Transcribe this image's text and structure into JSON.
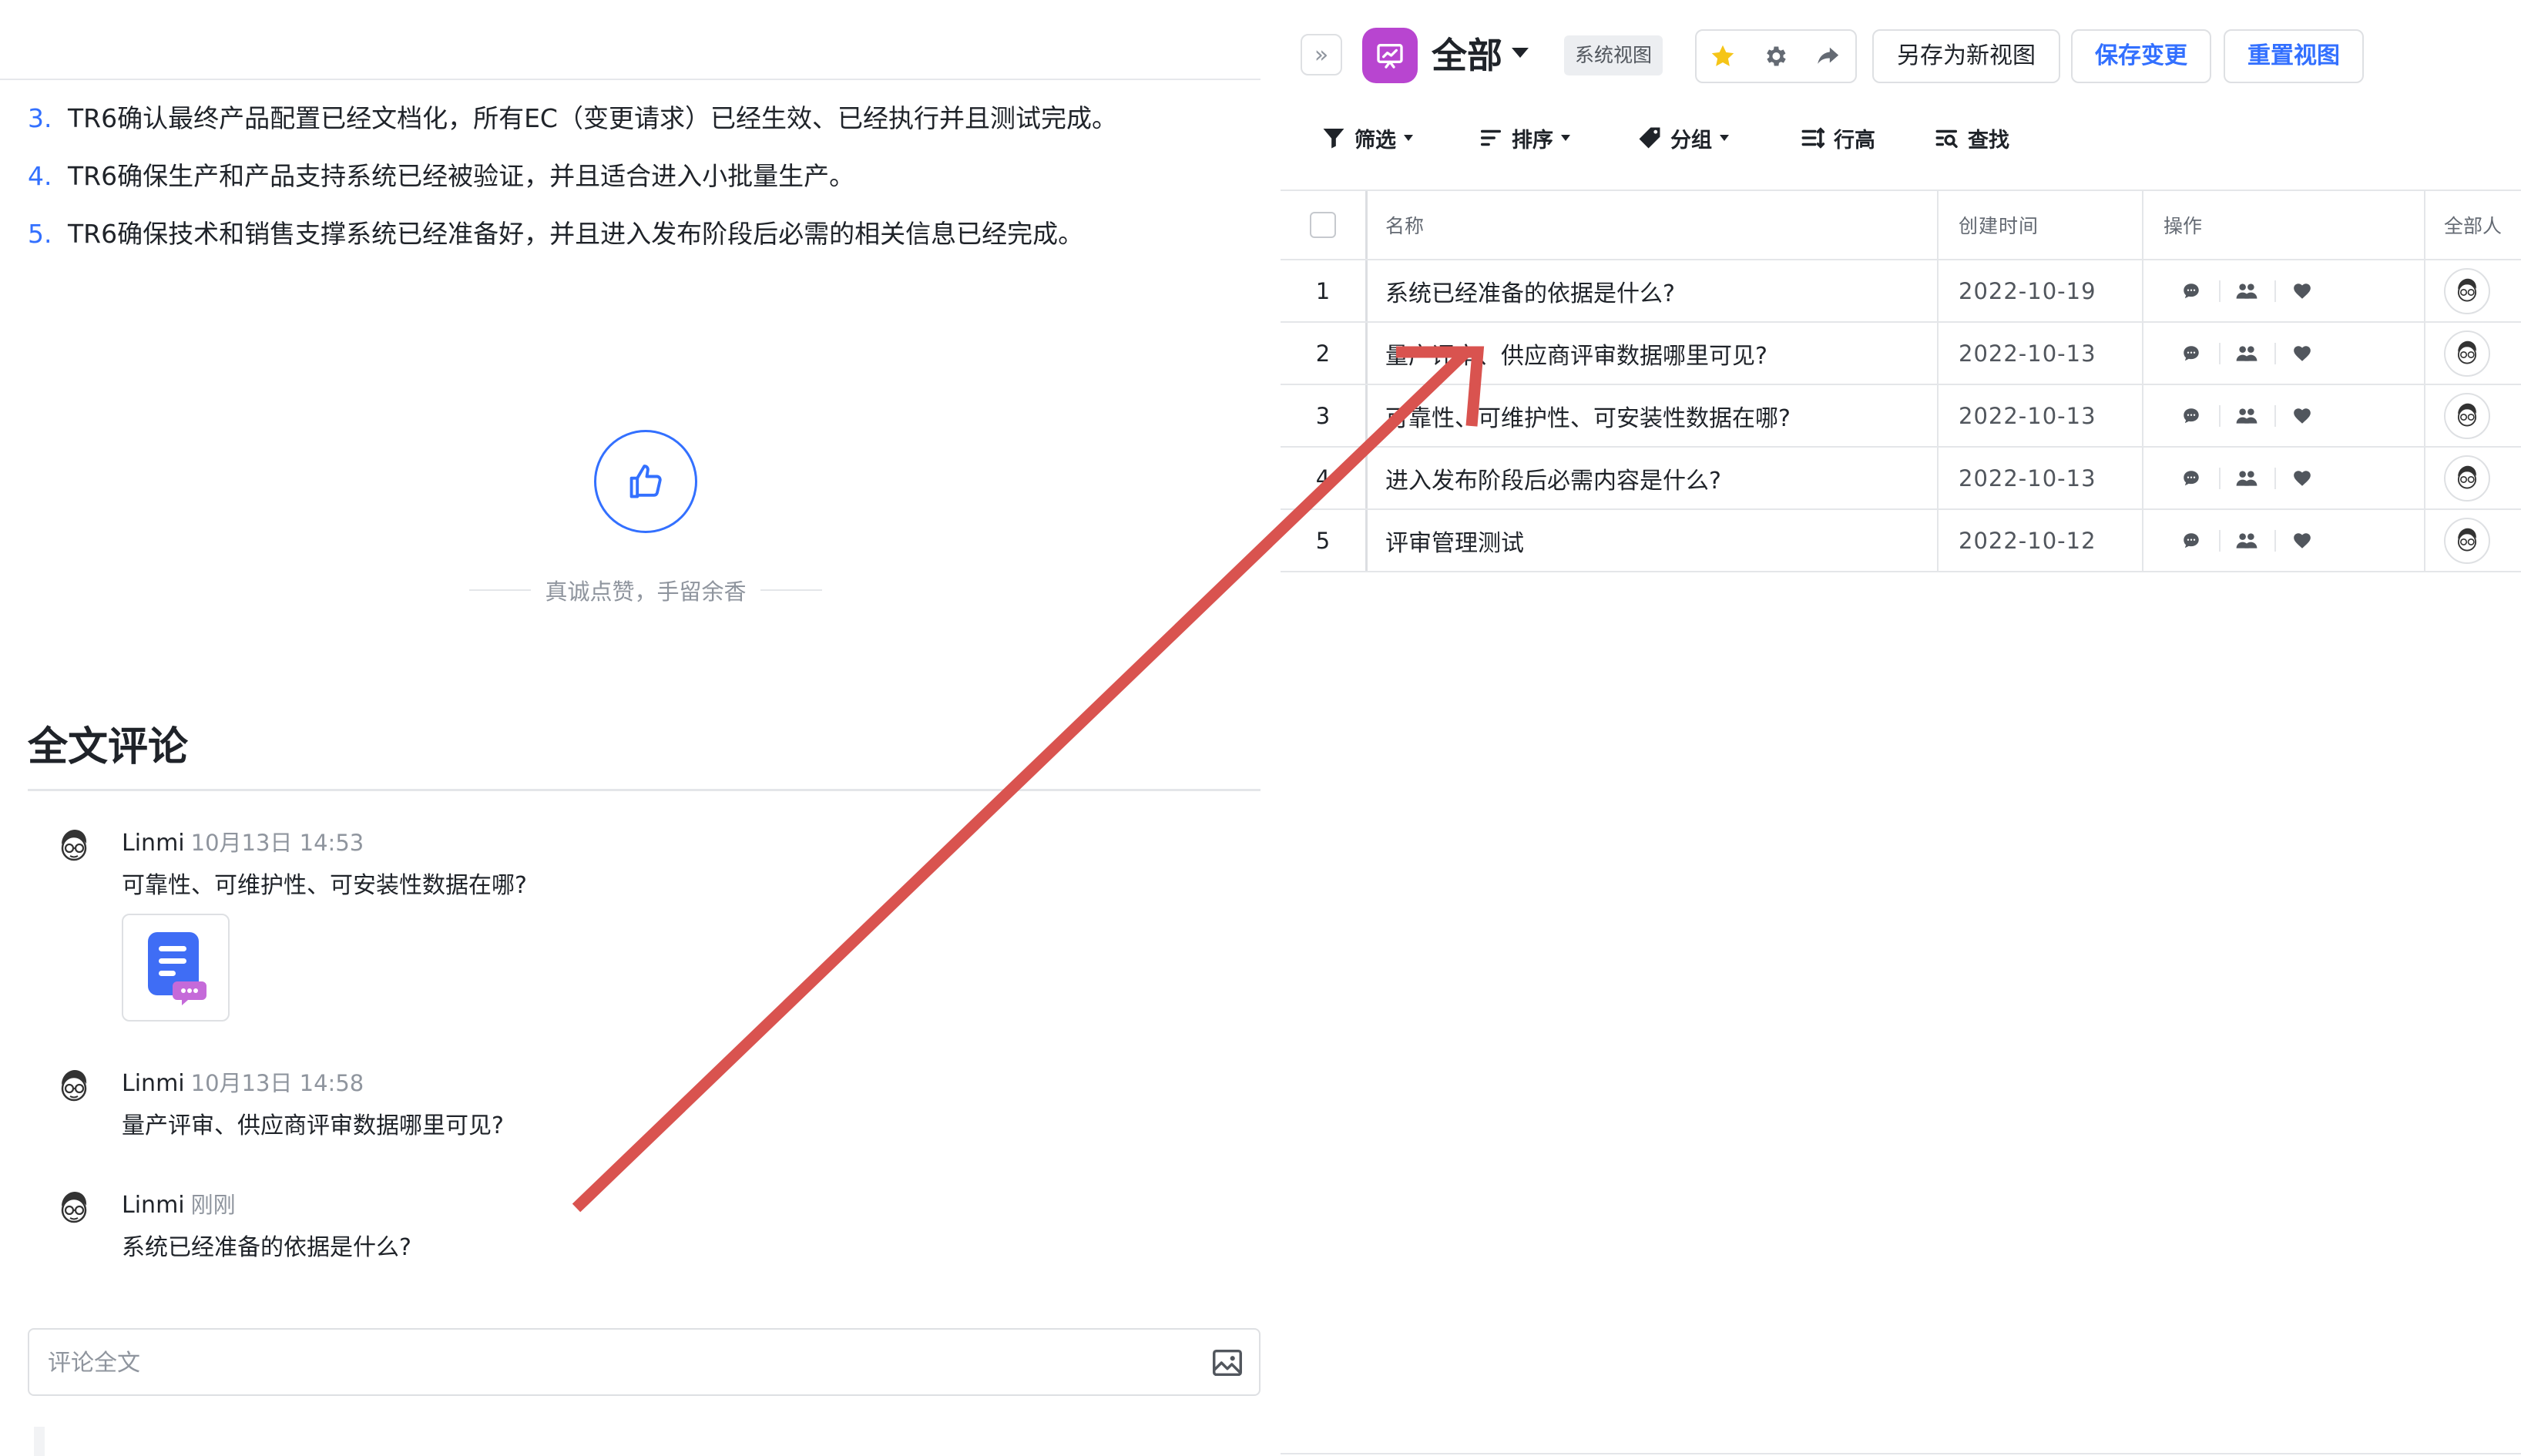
{
  "document": {
    "requirements": [
      {
        "num": "3.",
        "text": "TR6确认最终产品配置已经文档化，所有EC（变更请求）已经生效、已经执行并且测试完成。"
      },
      {
        "num": "4.",
        "text": "TR6确保生产和产品支持系统已经被验证，并且适合进入小批量生产。"
      },
      {
        "num": "5.",
        "text": "TR6确保技术和销售支撑系统已经准备好，并且进入发布阶段后必需的相关信息已经完成。"
      }
    ],
    "like_caption": "真诚点赞，手留余香"
  },
  "comments": {
    "title": "全文评论",
    "items": [
      {
        "author": "Linmi",
        "time": "10月13日 14:53",
        "text": "可靠性、可维护性、可安装性数据在哪?"
      },
      {
        "author": "Linmi",
        "time": "10月13日 14:58",
        "text": "量产评审、供应商评审数据哪里可见?"
      },
      {
        "author": "Linmi",
        "time": "刚刚",
        "text": "系统已经准备的依据是什么?"
      }
    ],
    "input_placeholder": "评论全文"
  },
  "view": {
    "title": "全部",
    "badge": "系统视图",
    "save_as_label": "另存为新视图",
    "save_label": "保存变更",
    "reset_label": "重置视图",
    "expand_glyph": "»",
    "accent": "#3370ff",
    "view_icon_color": "#b845d0",
    "favorite_color": "#f5c518"
  },
  "toolbar": {
    "filter_label": "筛选",
    "sort_label": "排序",
    "group_label": "分组",
    "row_height_label": "行高",
    "find_label": "查找"
  },
  "table": {
    "columns": {
      "name": "名称",
      "created": "创建时间",
      "ops": "操作",
      "all": "全部人"
    },
    "rows": [
      {
        "index": "1",
        "name": "系统已经准备的依据是什么?",
        "created": "2022-10-19"
      },
      {
        "index": "2",
        "name": "量产评审、供应商评审数据哪里可见?",
        "created": "2022-10-13"
      },
      {
        "index": "3",
        "name": "可靠性、可维护性、可安装性数据在哪?",
        "created": "2022-10-13"
      },
      {
        "index": "4",
        "name": "进入发布阶段后必需内容是什么?",
        "created": "2022-10-13"
      },
      {
        "index": "5",
        "name": "评审管理测试",
        "created": "2022-10-12"
      }
    ]
  },
  "annotation": {
    "arrow_color": "#d9534f"
  }
}
